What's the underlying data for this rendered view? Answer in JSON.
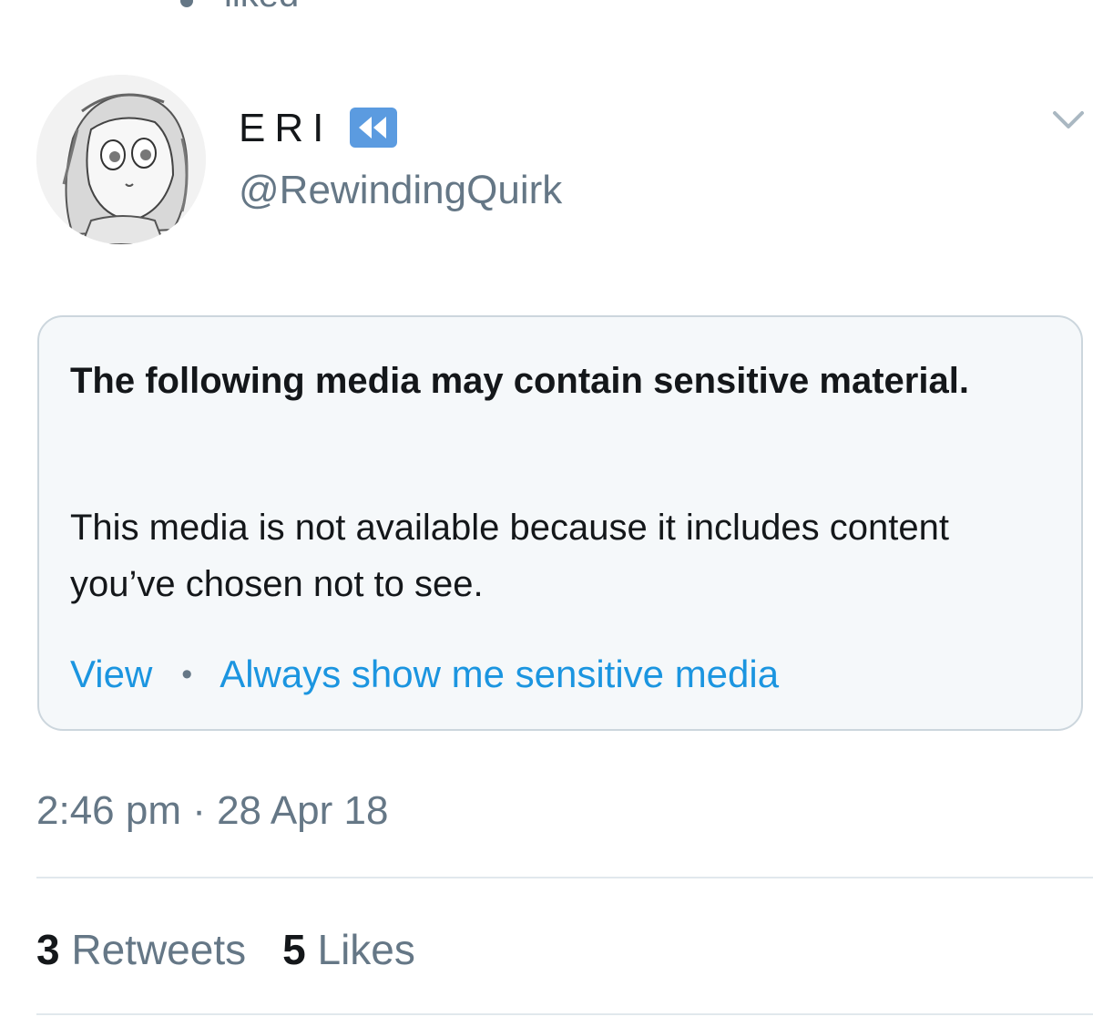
{
  "context": {
    "liked_label": "liked"
  },
  "author": {
    "display_name": "ERI",
    "display_emoji": "rewind-icon",
    "username": "@RewindingQuirk",
    "avatar": "anime-avatar-image"
  },
  "menu_icon": "chevron-down-icon",
  "sensitive_notice": {
    "heading": "The following media may contain sensitive material.",
    "body": "This media is not available because it includes content you’ve chosen not to see.",
    "view_label": "View",
    "separator": "•",
    "always_show_label": "Always show me sensitive media"
  },
  "timestamp": "2:46 pm · 28 Apr 18",
  "stats": {
    "retweets_count": "3",
    "retweets_label": "Retweets",
    "likes_count": "5",
    "likes_label": "Likes"
  },
  "colors": {
    "text_primary": "#14171a",
    "text_secondary": "#657786",
    "link_blue": "#1b95e0",
    "card_background": "#f5f8fa",
    "card_border": "#ccd6dd",
    "divider": "#e1e8ed",
    "emoji_blue": "#5b9be0"
  }
}
